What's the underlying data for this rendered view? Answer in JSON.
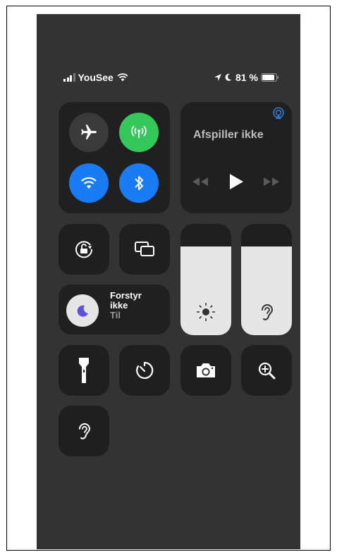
{
  "status_bar": {
    "carrier": "YouSee",
    "battery_percent": "81 %",
    "signal_icon": "signal-bars-icon",
    "wifi_icon": "wifi-icon",
    "location_icon": "location-arrow-icon",
    "moon_icon": "moon-icon",
    "battery_icon": "battery-icon"
  },
  "connectivity": {
    "airplane_mode": false,
    "cellular_data": true,
    "wifi": true,
    "bluetooth": true
  },
  "media": {
    "title": "Afspiller ikke"
  },
  "focus": {
    "title_line1": "Forstyr",
    "title_line2": "ikke",
    "state": "Til"
  },
  "brightness": {
    "level_pct": 80
  },
  "volume": {
    "level_pct": 80
  },
  "colors": {
    "background": "#333333",
    "tile": "#202020",
    "green": "#34c759",
    "blue": "#1a7cf5",
    "slider_fill": "#e6e6e6",
    "focus_moon": "#5856d6"
  }
}
